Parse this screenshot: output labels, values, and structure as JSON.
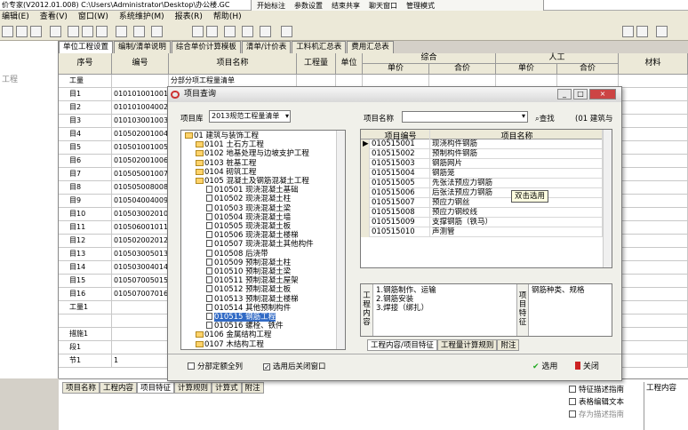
{
  "window": {
    "title": "价专家(V2012.01.008) C:\\Users\\Administrator\\Desktop\\办公楼.GC"
  },
  "floating_toolbar": {
    "items": [
      "开始标注",
      "参数设置",
      "结束共享",
      "聊天窗口",
      "管理模式"
    ]
  },
  "menubar": {
    "items": [
      "编辑(E)",
      "查看(V)",
      "窗口(W)",
      "系统维护(M)",
      "报表(R)",
      "帮助(H)"
    ]
  },
  "main_tabs": [
    "单位工程设置",
    "编制/清单说明",
    "综合单价计算模板",
    "清单/计价表",
    "工料机汇总表",
    "费用汇总表"
  ],
  "left_pane": {
    "label": "工程"
  },
  "grid": {
    "headers": {
      "seq": "序号",
      "code": "编号",
      "name": "项目名称",
      "qty": "工程量",
      "unit": "单位",
      "composite": "综合",
      "composite_unit_price": "单价",
      "composite_total": "合价",
      "labor": "人工",
      "labor_unit_price": "单价",
      "labor_total": "合价",
      "material": "材料"
    },
    "rows": [
      {
        "seq": "工量",
        "code": "",
        "name": "分部分项工程量清单"
      },
      {
        "seq": "目1",
        "code": "010101001001",
        "name": ""
      },
      {
        "seq": "目2",
        "code": "010101004002",
        "name": ""
      },
      {
        "seq": "目3",
        "code": "010103001003",
        "name": ""
      },
      {
        "seq": "目4",
        "code": "010502001004",
        "name": ""
      },
      {
        "seq": "目5",
        "code": "010501001005",
        "name": ""
      },
      {
        "seq": "目6",
        "code": "010502001006",
        "name": ""
      },
      {
        "seq": "目7",
        "code": "010505001007",
        "name": ""
      },
      {
        "seq": "目8",
        "code": "010505008008",
        "name": ""
      },
      {
        "seq": "目9",
        "code": "010504004009",
        "name": ""
      },
      {
        "seq": "目10",
        "code": "010503002010",
        "name": ""
      },
      {
        "seq": "目11",
        "code": "010506001011",
        "name": ""
      },
      {
        "seq": "目12",
        "code": "010502002012",
        "name": ""
      },
      {
        "seq": "目13",
        "code": "010503005013",
        "name": ""
      },
      {
        "seq": "目14",
        "code": "010503004014",
        "name": ""
      },
      {
        "seq": "目15",
        "code": "010507005015",
        "name": ""
      },
      {
        "seq": "目16",
        "code": "010507007016",
        "name": ""
      },
      {
        "seq": "工量1",
        "code": "",
        "name": ""
      },
      {
        "seq": "",
        "code": "",
        "name": ""
      },
      {
        "seq": "措施1",
        "code": "",
        "name": ""
      },
      {
        "seq": "段1",
        "code": "",
        "name": ""
      },
      {
        "seq": "节1",
        "code": "1",
        "name": ""
      }
    ]
  },
  "bottom_tabs": [
    "项目名称",
    "工程内容",
    "项目特征",
    "计算规则",
    "计算式",
    "附注"
  ],
  "bottom_right": {
    "header": "工程内容",
    "buttons": [
      "特征描述指南",
      "表格编辑文本",
      "存为描述指南"
    ]
  },
  "dialog": {
    "title": "项目查询",
    "library_label": "项目库",
    "library_value": "2013规范工程量清单",
    "name_label": "项目名称",
    "name_value": "",
    "search_label": "查找",
    "build_label": "(01 建筑与",
    "tree": [
      {
        "label": "01 建筑与装饰工程",
        "level": 0,
        "type": "folder"
      },
      {
        "label": "0101 土石方工程",
        "level": 1,
        "type": "folder"
      },
      {
        "label": "0102 地基处理与边坡支护工程",
        "level": 1,
        "type": "folder"
      },
      {
        "label": "0103 桩基工程",
        "level": 1,
        "type": "folder"
      },
      {
        "label": "0104 砌筑工程",
        "level": 1,
        "type": "folder"
      },
      {
        "label": "0105 混凝土及钢筋混凝土工程",
        "level": 1,
        "type": "folder"
      },
      {
        "label": "010501 现浇混凝土基础",
        "level": 2,
        "type": "page"
      },
      {
        "label": "010502 现浇混凝土柱",
        "level": 2,
        "type": "page"
      },
      {
        "label": "010503 现浇混凝土梁",
        "level": 2,
        "type": "page"
      },
      {
        "label": "010504 现浇混凝土墙",
        "level": 2,
        "type": "page"
      },
      {
        "label": "010505 现浇混凝土板",
        "level": 2,
        "type": "page"
      },
      {
        "label": "010506 现浇混凝土楼梯",
        "level": 2,
        "type": "page"
      },
      {
        "label": "010507 现浇混凝土其他构件",
        "level": 2,
        "type": "page"
      },
      {
        "label": "010508 后浇带",
        "level": 2,
        "type": "page"
      },
      {
        "label": "010509 预制混凝土柱",
        "level": 2,
        "type": "page"
      },
      {
        "label": "010510 预制混凝土梁",
        "level": 2,
        "type": "page"
      },
      {
        "label": "010511 预制混凝土屋架",
        "level": 2,
        "type": "page"
      },
      {
        "label": "010512 预制混凝土板",
        "level": 2,
        "type": "page"
      },
      {
        "label": "010513 预制混凝土楼梯",
        "level": 2,
        "type": "page"
      },
      {
        "label": "010514 其他预制构件",
        "level": 2,
        "type": "page"
      },
      {
        "label": "010515 钢筋工程",
        "level": 2,
        "type": "page",
        "selected": true
      },
      {
        "label": "010516 螺栓、铁件",
        "level": 2,
        "type": "page"
      },
      {
        "label": "0106 金属结构工程",
        "level": 1,
        "type": "folder"
      },
      {
        "label": "0107 木结构工程",
        "level": 1,
        "type": "folder"
      }
    ],
    "list_headers": {
      "code": "项目编号",
      "name": "项目名称"
    },
    "list_rows": [
      {
        "code": "010515001",
        "name": "现浇构件钢筋"
      },
      {
        "code": "010515002",
        "name": "预制构件钢筋"
      },
      {
        "code": "010515003",
        "name": "钢筋网片"
      },
      {
        "code": "010515004",
        "name": "钢筋笼"
      },
      {
        "code": "010515005",
        "name": "先张法预应力钢筋"
      },
      {
        "code": "010515006",
        "name": "后张法预应力钢筋"
      },
      {
        "code": "010515007",
        "name": "预应力钢丝"
      },
      {
        "code": "010515008",
        "name": "预应力钢绞线"
      },
      {
        "code": "010515009",
        "name": "支撑钢筋（铁马）"
      },
      {
        "code": "010515010",
        "name": "声测管"
      }
    ],
    "tooltip": "双击选用",
    "work_content_label": "工程内容",
    "work_content": [
      "1.钢筋制作、运输",
      "2.钢筋安装",
      "3.焊接（绑扎）"
    ],
    "feature_label": "项目特征",
    "feature_text": "钢筋种类、规格",
    "detail_tabs": [
      "工程内容/项目特征",
      "工程量计算规则",
      "附注"
    ],
    "opt_all_sections": "分部定额全列",
    "opt_close_after": "选用后关闭窗口",
    "select_label": "选用",
    "close_label": "关闭"
  }
}
